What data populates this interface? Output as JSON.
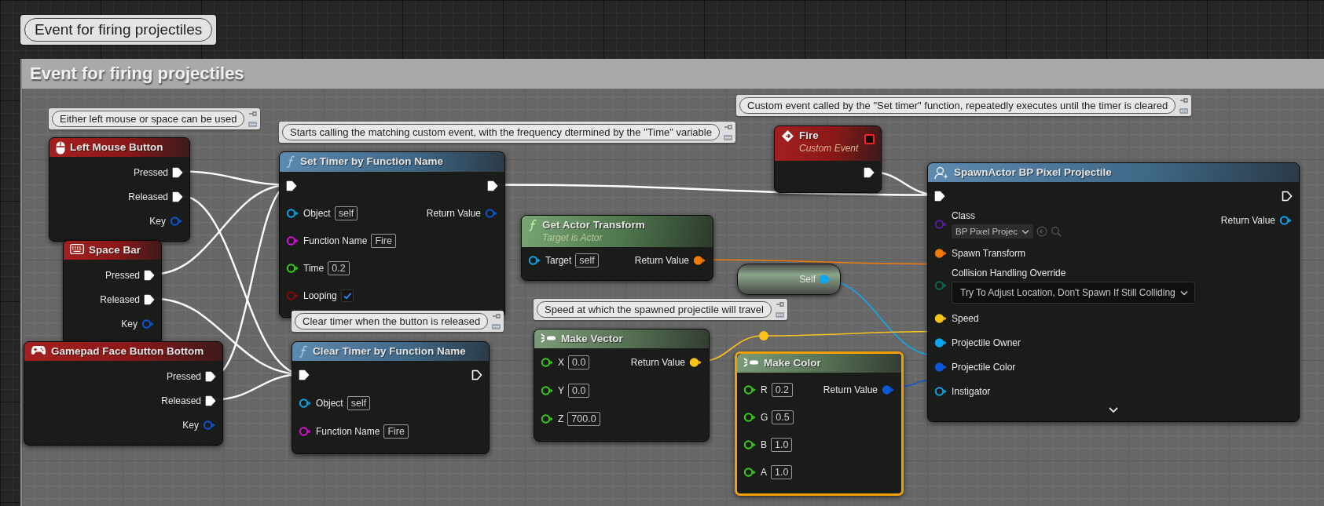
{
  "top_comment": {
    "text": "Event for firing projectiles"
  },
  "comment_box": {
    "title": "Event for firing projectiles"
  },
  "comments": [
    {
      "text": "Either left mouse or space can be used"
    },
    {
      "text": "Starts calling the matching custom event, with the frequency dtermined by the \"Time\" variable"
    },
    {
      "text": "Clear timer when the button is released"
    },
    {
      "text": "Custom event called by the \"Set timer\" function, repeatedly executes until the timer is cleared"
    },
    {
      "text": "Speed at which the spawned projectile will travel"
    }
  ],
  "nodes": [
    {
      "kind": "mouse",
      "title": "Left Mouse Button",
      "selected": false,
      "outputs": [
        {
          "label": "Pressed",
          "kind": "exec",
          "connected": true
        },
        {
          "label": "Released",
          "kind": "exec",
          "connected": true
        },
        {
          "label": "Key",
          "kind": "struct",
          "connected": false
        }
      ]
    },
    {
      "kind": "keyboard",
      "title": "Space Bar",
      "selected": false,
      "outputs": [
        {
          "label": "Pressed",
          "kind": "exec",
          "connected": true
        },
        {
          "label": "Released",
          "kind": "exec",
          "connected": true
        },
        {
          "label": "Key",
          "kind": "struct",
          "connected": false
        }
      ]
    },
    {
      "kind": "gamepad",
      "title": "Gamepad Face Button Bottom",
      "selected": false,
      "outputs": [
        {
          "label": "Pressed",
          "kind": "exec",
          "connected": true
        },
        {
          "label": "Released",
          "kind": "exec",
          "connected": true
        },
        {
          "label": "Key",
          "kind": "struct",
          "connected": false
        }
      ]
    },
    {
      "kind": "function",
      "title": "Set Timer by Function Name",
      "selected": false,
      "inputs": [
        {
          "kind": "exec",
          "connected": true
        },
        {
          "label": "Object",
          "kind": "object",
          "connected": false,
          "value": "self"
        },
        {
          "label": "Function Name",
          "kind": "name",
          "connected": false,
          "value": "Fire"
        },
        {
          "label": "Time",
          "kind": "float",
          "connected": false,
          "value": "0.2"
        },
        {
          "label": "Looping",
          "kind": "bool",
          "connected": false,
          "checked": true
        }
      ],
      "outputs": [
        {
          "kind": "exec",
          "connected": true
        },
        {
          "label": "Return Value",
          "kind": "struct",
          "connected": false
        }
      ]
    },
    {
      "kind": "function",
      "title": "Clear Timer by Function Name",
      "selected": false,
      "inputs": [
        {
          "kind": "exec",
          "connected": true
        },
        {
          "label": "Object",
          "kind": "object",
          "connected": false,
          "value": "self"
        },
        {
          "label": "Function Name",
          "kind": "name",
          "connected": false,
          "value": "Fire"
        }
      ],
      "outputs": [
        {
          "kind": "exec",
          "connected": false
        }
      ]
    },
    {
      "kind": "custom_event",
      "title": "Fire",
      "subtitle": "Custom Event",
      "selected": false,
      "outputs": [
        {
          "kind": "exec",
          "connected": true
        }
      ]
    },
    {
      "kind": "pure_function",
      "title": "Get Actor Transform",
      "subtitle": "Target is Actor",
      "selected": false,
      "inputs": [
        {
          "label": "Target",
          "kind": "object",
          "connected": false,
          "value": "self"
        }
      ],
      "outputs": [
        {
          "label": "Return Value",
          "kind": "transform",
          "connected": true
        }
      ]
    },
    {
      "kind": "variable",
      "selected": false,
      "outputs": [
        {
          "label": "Self",
          "kind": "object",
          "connected": true
        }
      ]
    },
    {
      "kind": "make_struct",
      "title": "Make Vector",
      "selected": false,
      "inputs": [
        {
          "label": "X",
          "kind": "float",
          "connected": false,
          "value": "0.0"
        },
        {
          "label": "Y",
          "kind": "float",
          "connected": false,
          "value": "0.0"
        },
        {
          "label": "Z",
          "kind": "float",
          "connected": false,
          "value": "700.0"
        }
      ],
      "outputs": [
        {
          "label": "Return Value",
          "kind": "vector",
          "connected": true
        }
      ]
    },
    {
      "kind": "make_struct",
      "title": "Make Color",
      "selected": true,
      "inputs": [
        {
          "label": "R",
          "kind": "float",
          "connected": false,
          "value": "0.2"
        },
        {
          "label": "G",
          "kind": "float",
          "connected": false,
          "value": "0.5"
        },
        {
          "label": "B",
          "kind": "float",
          "connected": false,
          "value": "1.0"
        },
        {
          "label": "A",
          "kind": "float",
          "connected": false,
          "value": "1.0"
        }
      ],
      "outputs": [
        {
          "label": "Return Value",
          "kind": "struct",
          "connected": true
        }
      ]
    },
    {
      "kind": "spawn",
      "title": "SpawnActor BP Pixel Projectile",
      "selected": false,
      "inputs": [
        {
          "kind": "exec",
          "connected": true
        },
        {
          "label": "Class",
          "kind": "class",
          "connected": false,
          "value": "BP Pixel Projec"
        },
        {
          "label": "Spawn Transform",
          "kind": "transform",
          "connected": true
        },
        {
          "label": "Collision Handling Override",
          "kind": "enum",
          "connected": false,
          "value": "Try To Adjust Location, Don't Spawn If Still Colliding"
        },
        {
          "label": "Speed",
          "kind": "vector",
          "connected": true
        },
        {
          "label": "Projectile Owner",
          "kind": "object",
          "connected": true
        },
        {
          "label": "Projectile Color",
          "kind": "struct",
          "connected": true
        },
        {
          "label": "Instigator",
          "kind": "object",
          "connected": false
        }
      ],
      "outputs": [
        {
          "kind": "exec",
          "connected": false
        },
        {
          "label": "Return Value",
          "kind": "object",
          "connected": false
        }
      ]
    }
  ]
}
